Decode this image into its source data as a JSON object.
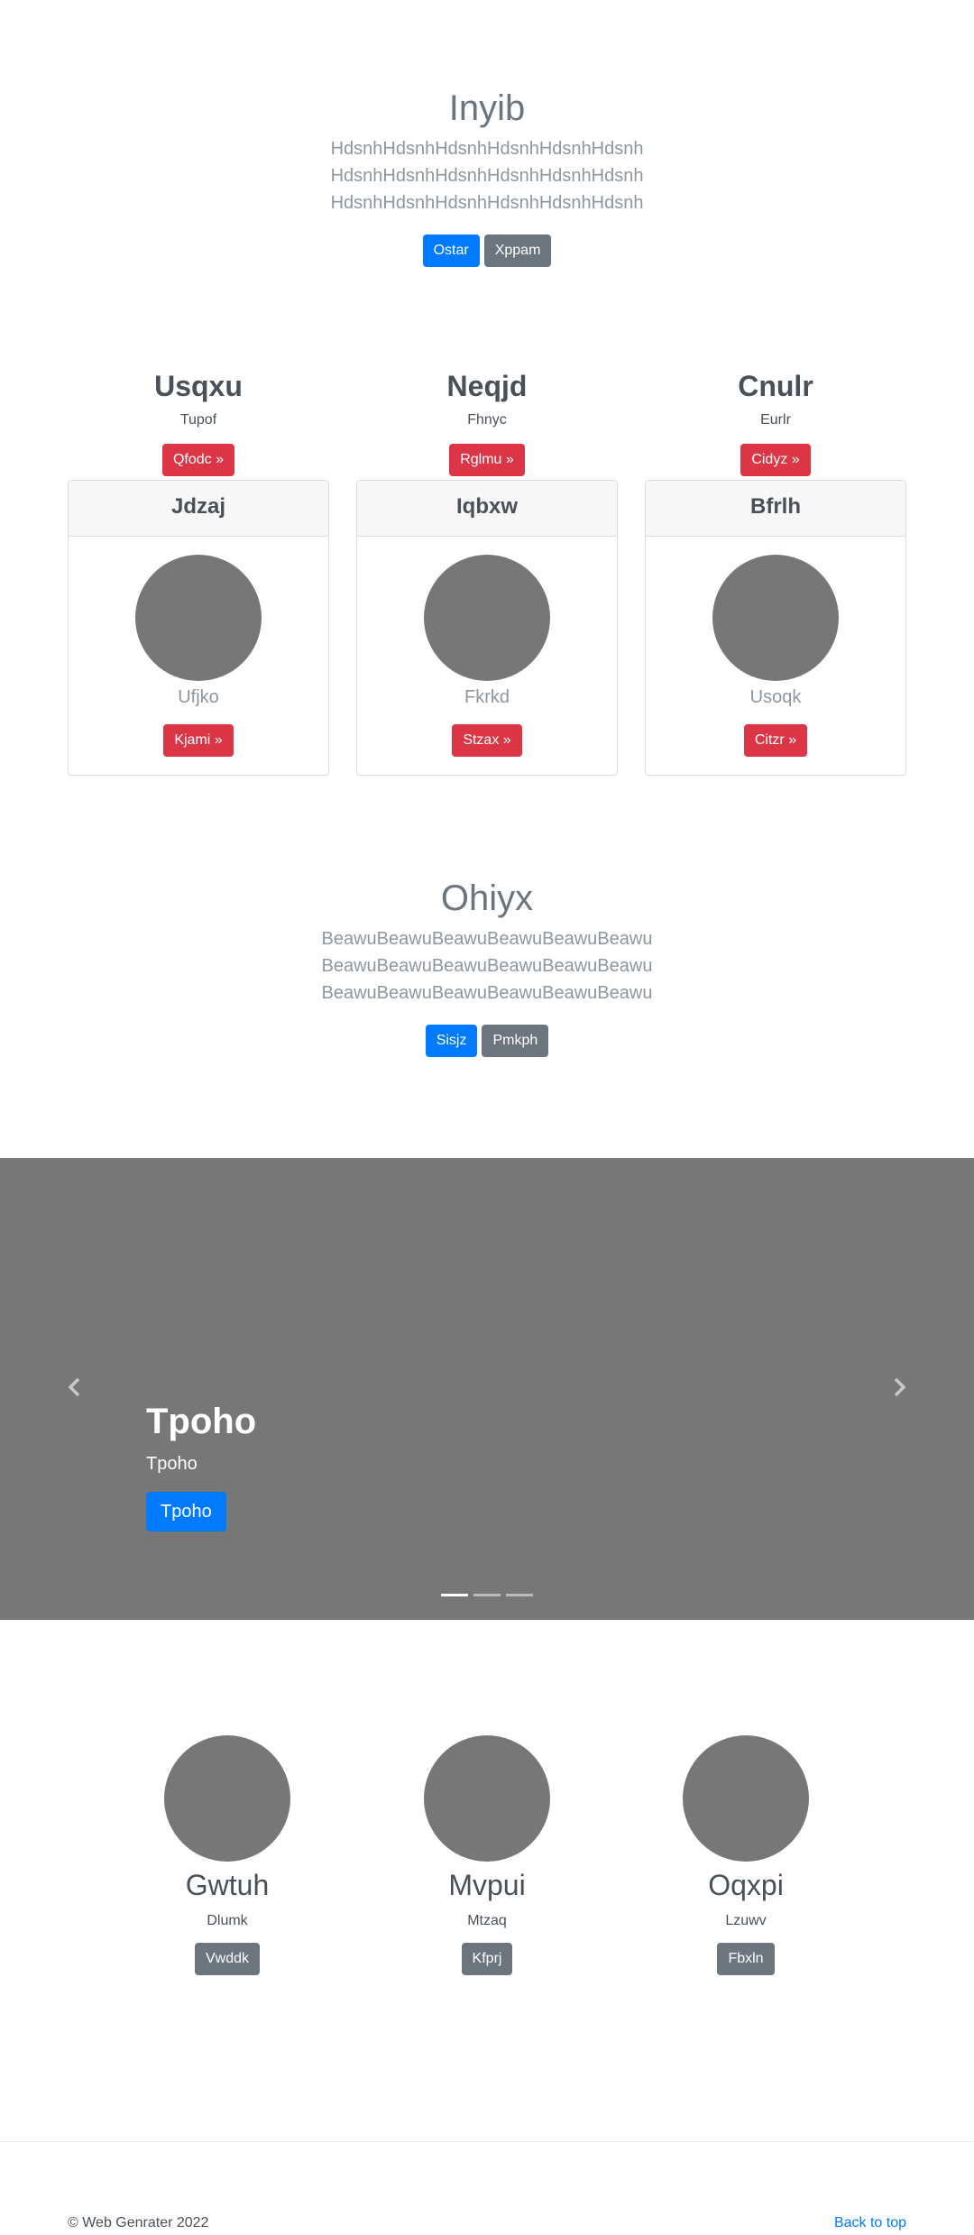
{
  "hero1": {
    "title": "Inyib",
    "lines": [
      "HdsnhHdsnhHdsnhHdsnhHdsnhHdsnh",
      "HdsnhHdsnhHdsnhHdsnhHdsnhHdsnh",
      "HdsnhHdsnhHdsnhHdsnhHdsnhHdsnh"
    ],
    "primary_label": "Ostar",
    "secondary_label": "Xppam"
  },
  "columns": [
    {
      "title": "Usqxu",
      "sub": "Tupof",
      "button": "Qfodc »"
    },
    {
      "title": "Neqjd",
      "sub": "Fhnyc",
      "button": "Rglmu »"
    },
    {
      "title": "Cnulr",
      "sub": "Eurlr",
      "button": "Cidyz »"
    }
  ],
  "cards": [
    {
      "header": "Jdzaj",
      "name": "Ufjko",
      "button": "Kjami »"
    },
    {
      "header": "Iqbxw",
      "name": "Fkrkd",
      "button": "Stzax »"
    },
    {
      "header": "Bfrlh",
      "name": "Usoqk",
      "button": "Citzr »"
    }
  ],
  "hero2": {
    "title": "Ohiyx",
    "lines": [
      "BeawuBeawuBeawuBeawuBeawuBeawu",
      "BeawuBeawuBeawuBeawuBeawuBeawu",
      "BeawuBeawuBeawuBeawuBeawuBeawu"
    ],
    "primary_label": "Sisjz",
    "secondary_label": "Pmkph"
  },
  "carousel": {
    "title": "Tpoho",
    "text": "Tpoho",
    "button": "Tpoho",
    "prev_icon": "chevron-left-icon",
    "next_icon": "chevron-right-icon",
    "slide_count": 3,
    "active_slide": 1
  },
  "marketing": [
    {
      "title": "Gwtuh",
      "sub": "Dlumk",
      "button": "Vwddk"
    },
    {
      "title": "Mvpui",
      "sub": "Mtzaq",
      "button": "Kfprj"
    },
    {
      "title": "Oqxpi",
      "sub": "Lzuwv",
      "button": "Fbxln"
    }
  ],
  "footer": {
    "copyright": "© Web Genrater 2022",
    "back_to_top": "Back to top"
  },
  "colors": {
    "primary": "#007bff",
    "secondary": "#6c757d",
    "danger": "#dc3545",
    "placeholder": "#777777"
  }
}
